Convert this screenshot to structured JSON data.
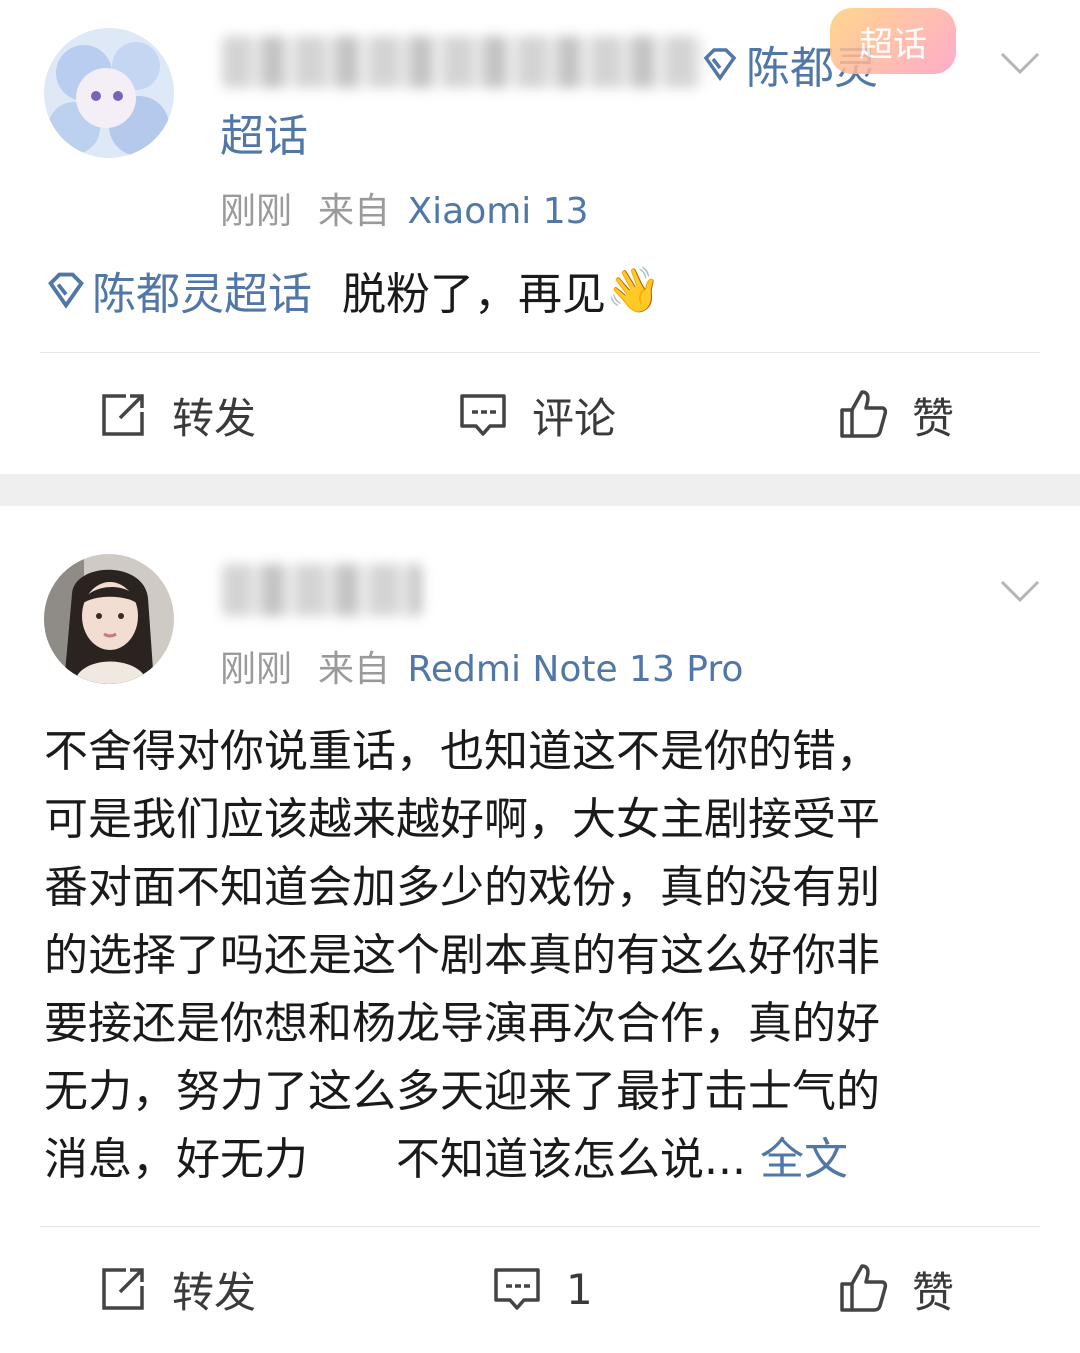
{
  "posts": [
    {
      "topic_name": "陈都灵",
      "topic_suffix": "超话",
      "badge": "超话",
      "time": "刚刚",
      "source_prefix": "来自",
      "device": "Xiaomi 13",
      "topic_tag": "陈都灵超话",
      "text": "脱粉了，再见",
      "emoji": "👋",
      "actions": {
        "repost": "转发",
        "comment": "评论",
        "like": "赞"
      }
    },
    {
      "time": "刚刚",
      "source_prefix": "来自",
      "device": "Redmi Note 13 Pro",
      "text_lines": [
        "不舍得对你说重话，也知道这不是你的错，",
        "可是我们应该越来越好啊，大女主剧接受平",
        "番对面不知道会加多少的戏份，真的没有别",
        "的选择了吗还是这个剧本真的有这么好你非",
        "要接还是你想和杨龙导演再次合作，真的好",
        "无力，努力了这么多天迎来了最打击士气的",
        "消息，好无力　　不知道该怎么说..."
      ],
      "full_text_link": "全文",
      "actions": {
        "repost": "转发",
        "comment": "1",
        "like": "赞"
      }
    }
  ],
  "icons": {
    "topic": "diamond-topic-icon",
    "repost": "repost-icon",
    "comment": "comment-icon",
    "like": "thumbs-up-icon",
    "more": "chevron-down-icon"
  },
  "colors": {
    "link": "#5177a8",
    "meta": "#9a9a9a",
    "separator": "#efefef"
  }
}
